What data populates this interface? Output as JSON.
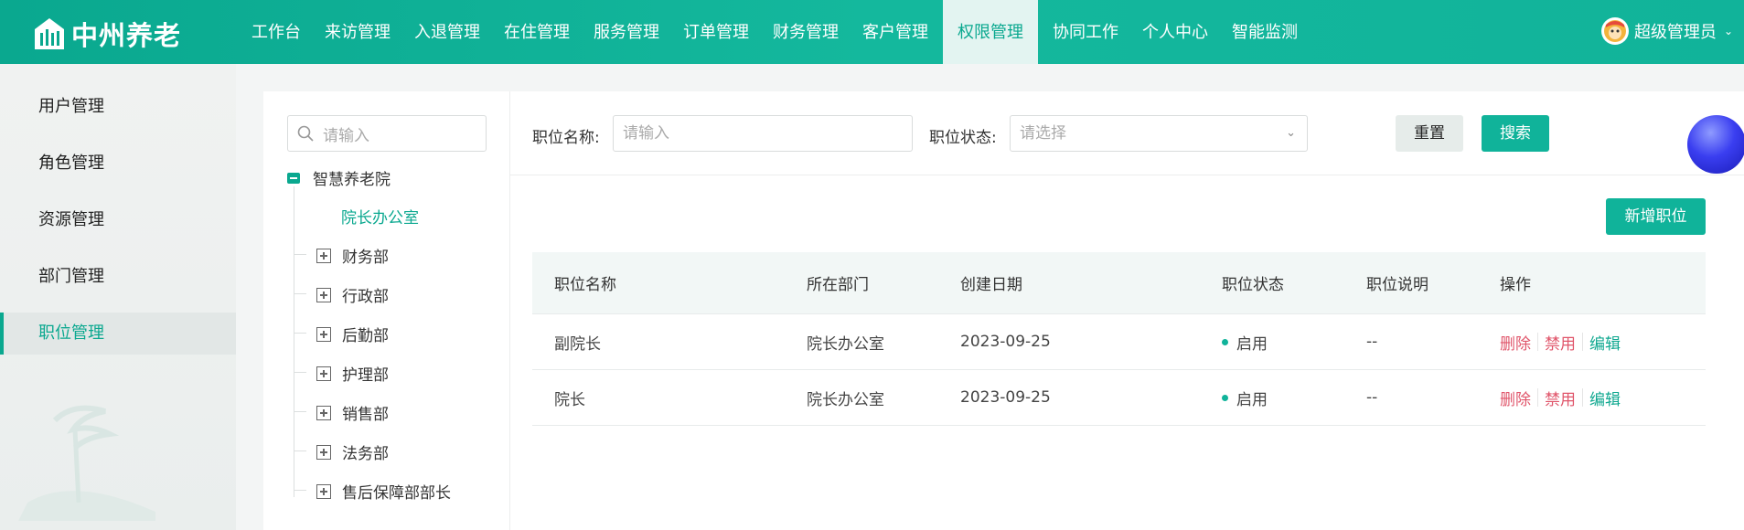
{
  "header": {
    "brand": "中州养老",
    "nav": [
      "工作台",
      "来访管理",
      "入退管理",
      "在住管理",
      "服务管理",
      "订单管理",
      "财务管理",
      "客户管理",
      "权限管理",
      "协同工作",
      "个人中心",
      "智能监测"
    ],
    "active_nav": "权限管理",
    "user": "超级管理员",
    "colors": {
      "primary": "#0aa88f",
      "danger": "#e0566b"
    }
  },
  "sidebar": {
    "items": [
      "用户管理",
      "角色管理",
      "资源管理",
      "部门管理",
      "职位管理"
    ],
    "active": "职位管理"
  },
  "tree": {
    "search_placeholder": "请输入",
    "root": "智慧养老院",
    "nodes": [
      "院长办公室",
      "财务部",
      "行政部",
      "后勤部",
      "护理部",
      "销售部",
      "法务部",
      "售后保障部部长"
    ],
    "selected": "院长办公室"
  },
  "filters": {
    "name_label": "职位名称:",
    "name_placeholder": "请输入",
    "status_label": "职位状态:",
    "status_placeholder": "请选择",
    "reset": "重置",
    "search": "搜索"
  },
  "actions": {
    "add": "新增职位"
  },
  "table": {
    "headers": [
      "职位名称",
      "所在部门",
      "创建日期",
      "职位状态",
      "职位说明",
      "操作"
    ],
    "rows": [
      {
        "name": "副院长",
        "dept": "院长办公室",
        "date": "2023-09-25",
        "status": "启用",
        "desc": "--"
      },
      {
        "name": "院长",
        "dept": "院长办公室",
        "date": "2023-09-25",
        "status": "启用",
        "desc": "--"
      }
    ],
    "row_actions": {
      "delete": "删除",
      "disable": "禁用",
      "edit": "编辑"
    }
  }
}
